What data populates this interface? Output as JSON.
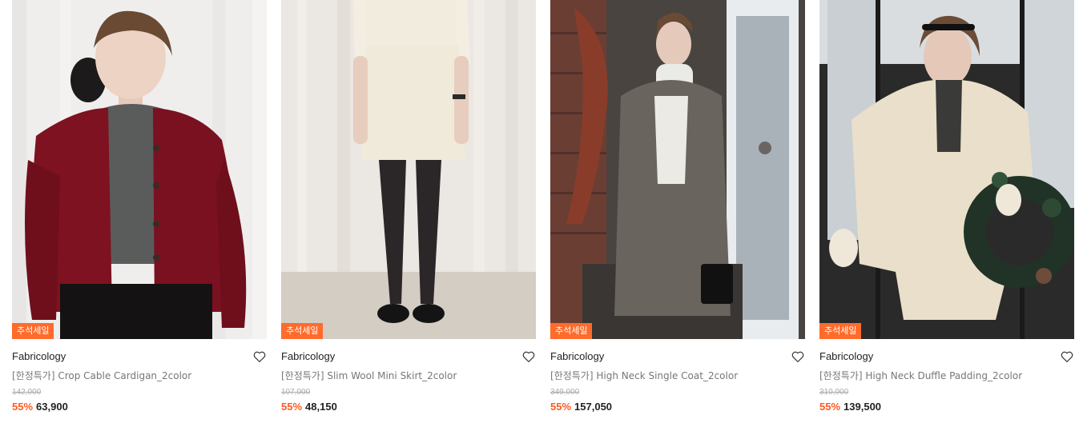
{
  "products": [
    {
      "badge": "추석세일",
      "brand": "Fabricology",
      "title": "[한정특가] Crop Cable Cardigan_2color",
      "original_price": "142,000",
      "discount": "55%",
      "price": "63,900",
      "wishlist_icon": "heart-outline-icon"
    },
    {
      "badge": "추석세일",
      "brand": "Fabricology",
      "title": "[한정특가] Slim Wool Mini Skirt_2color",
      "original_price": "107,000",
      "discount": "55%",
      "price": "48,150",
      "wishlist_icon": "heart-outline-icon"
    },
    {
      "badge": "추석세일",
      "brand": "Fabricology",
      "title": "[한정특가] High Neck Single Coat_2color",
      "original_price": "349,000",
      "discount": "55%",
      "price": "157,050",
      "wishlist_icon": "heart-outline-icon"
    },
    {
      "badge": "추석세일",
      "brand": "Fabricology",
      "title": "[한정특가] High Neck Duffle Padding_2color",
      "original_price": "310,000",
      "discount": "55%",
      "price": "139,500",
      "wishlist_icon": "heart-outline-icon"
    }
  ],
  "colors": {
    "badge_bg": "#ff6b2b",
    "discount": "#ff5a1f",
    "brand_text": "#222222",
    "title_text": "#777777",
    "strike_price": "#aaaaaa"
  }
}
